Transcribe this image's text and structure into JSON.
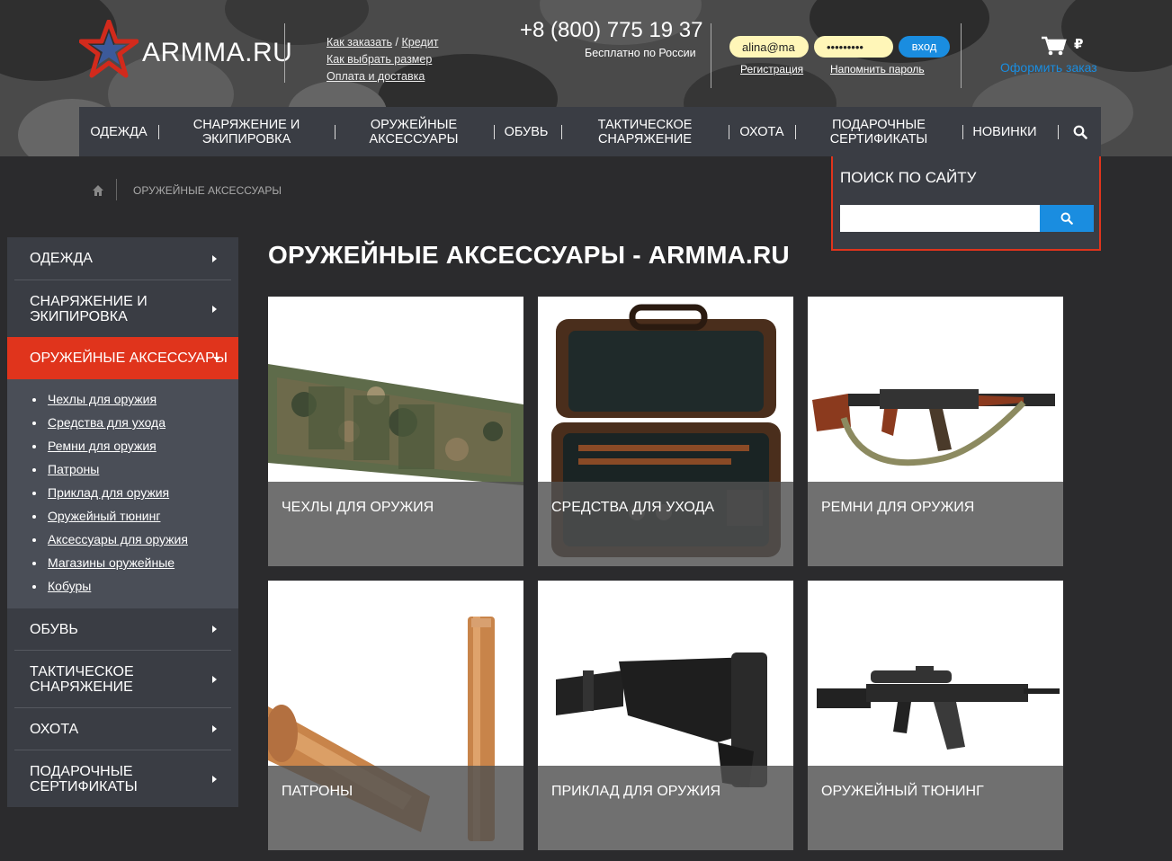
{
  "header": {
    "logo_text": "ARMMA.RU",
    "help_links": {
      "order": "Как заказать",
      "slash": "/",
      "credit": "Кредит",
      "size": "Как выбрать размер",
      "delivery": "Оплата и доставка"
    },
    "phone": "+8 (800) 775 19 37",
    "phone_note": "Бесплатно по России",
    "login_value": "alina@ma",
    "password_value": "•••••••••",
    "login_button": "вход",
    "register_link": "Регистрация",
    "remind_link": "Напомнить пароль",
    "currency": "₽",
    "checkout": "Оформить заказ"
  },
  "nav": {
    "items": [
      "Одежда",
      "Снаряжение и экипировка",
      "Оружейные аксессуары",
      "Обувь",
      "Тактическое снаряжение",
      "Охота",
      "Подарочные сертификаты",
      "Новинки"
    ]
  },
  "search": {
    "title": "Поиск по сайту",
    "value": ""
  },
  "breadcrumb": {
    "current": "Оружейные аксессуары"
  },
  "sidebar": {
    "items": [
      "Одежда",
      "Снаряжение и экипировка",
      "Оружейные аксессуары",
      "Обувь",
      "Тактическое снаряжение",
      "Охота",
      "Подарочные сертификаты"
    ],
    "sub_items": [
      "Чехлы для оружия",
      "Средства для ухода",
      "Ремни для оружия",
      "Патроны",
      "Приклад для оружия",
      "Оружейный тюнинг",
      "Аксессуары для оружия",
      "Магазины оружейные",
      "Кобуры"
    ]
  },
  "main": {
    "title": "Оружейные аксессуары - ARMMA.RU",
    "cards": [
      "Чехлы для оружия",
      "Средства для ухода",
      "Ремни для оружия",
      "Патроны",
      "Приклад для оружия",
      "Оружейный тюнинг"
    ]
  },
  "colors": {
    "accent_red": "#e0341c",
    "accent_blue": "#1a8de0",
    "nav_bg": "#3a3d44",
    "page_bg": "#2b2b2d"
  }
}
